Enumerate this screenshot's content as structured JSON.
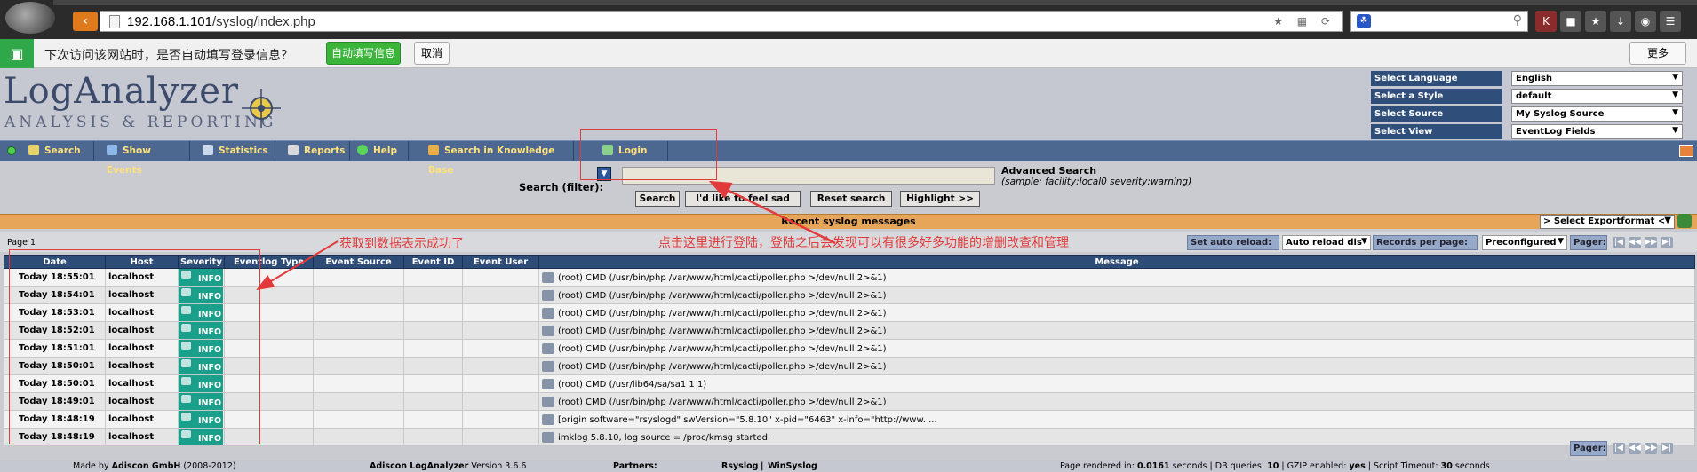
{
  "browser": {
    "url_host": "192.168.1.101",
    "url_path": "/syslog/index.php",
    "password_bar": {
      "message": "下次访问该网站时，是否自动填写登录信息？",
      "autofill_label": "自动填写信息",
      "cancel_label": "取消",
      "more_label": "更多"
    }
  },
  "app": {
    "logo_main": "LogAnalyzer",
    "logo_sub": "ANALYSIS & REPORTING",
    "selectors": [
      {
        "label": "Select Language",
        "value": "English"
      },
      {
        "label": "Select a Style",
        "value": "default"
      },
      {
        "label": "Select Source",
        "value": "My Syslog Source"
      },
      {
        "label": "Select View",
        "value": "EventLog Fields"
      }
    ],
    "nav": [
      "Search",
      "Show Events",
      "Statistics",
      "Reports",
      "Help",
      "Search in Knowledge Base",
      "Login"
    ]
  },
  "search": {
    "label": "Search (filter):",
    "advanced_label": "Advanced Search",
    "sample": "(sample: facility:local0 severity:warning)",
    "buttons": [
      "Search",
      "I'd like to feel sad",
      "Reset search",
      "Highlight >>"
    ]
  },
  "results": {
    "title": "Recent syslog messages",
    "export_label": "> Select Exportformat <",
    "page_label": "Page 1",
    "auto_reload_label": "Set auto reload:",
    "auto_reload_value": "Auto reload dis",
    "records_label": "Records per page:",
    "records_value": "Preconfigured",
    "pager_label": "Pager:",
    "columns": [
      "Date",
      "Host",
      "Severity",
      "Eventlog Type",
      "Event Source",
      "Event ID",
      "Event User",
      "Message"
    ],
    "rows": [
      {
        "date": "Today 18:55:01",
        "host": "localhost",
        "severity": "INFO",
        "message": "(root) CMD (/usr/bin/php /var/www/html/cacti/poller.php >/dev/null 2>&1)"
      },
      {
        "date": "Today 18:54:01",
        "host": "localhost",
        "severity": "INFO",
        "message": "(root) CMD (/usr/bin/php /var/www/html/cacti/poller.php >/dev/null 2>&1)"
      },
      {
        "date": "Today 18:53:01",
        "host": "localhost",
        "severity": "INFO",
        "message": "(root) CMD (/usr/bin/php /var/www/html/cacti/poller.php >/dev/null 2>&1)"
      },
      {
        "date": "Today 18:52:01",
        "host": "localhost",
        "severity": "INFO",
        "message": "(root) CMD (/usr/bin/php /var/www/html/cacti/poller.php >/dev/null 2>&1)"
      },
      {
        "date": "Today 18:51:01",
        "host": "localhost",
        "severity": "INFO",
        "message": "(root) CMD (/usr/bin/php /var/www/html/cacti/poller.php >/dev/null 2>&1)"
      },
      {
        "date": "Today 18:50:01",
        "host": "localhost",
        "severity": "INFO",
        "message": "(root) CMD (/usr/bin/php /var/www/html/cacti/poller.php >/dev/null 2>&1)"
      },
      {
        "date": "Today 18:50:01",
        "host": "localhost",
        "severity": "INFO",
        "message": "(root) CMD (/usr/lib64/sa/sa1 1 1)"
      },
      {
        "date": "Today 18:49:01",
        "host": "localhost",
        "severity": "INFO",
        "message": "(root) CMD (/usr/bin/php /var/www/html/cacti/poller.php >/dev/null 2>&1)"
      },
      {
        "date": "Today 18:48:19",
        "host": "localhost",
        "severity": "INFO",
        "message": "[origin software=\"rsyslogd\" swVersion=\"5.8.10\" x-pid=\"6463\" x-info=\"http://www. ..."
      },
      {
        "date": "Today 18:48:19",
        "host": "localhost",
        "severity": "INFO",
        "message": "imklog 5.8.10, log source = /proc/kmsg started."
      }
    ]
  },
  "footer": {
    "made_by_prefix": "Made by",
    "made_by_company": "Adiscon GmbH",
    "made_by_years": "(2008-2012)",
    "product": "Adiscon LogAnalyzer",
    "version": "Version 3.6.6",
    "partners_label": "Partners:",
    "partner1": "Rsyslog",
    "partner2": "WinSyslog",
    "rendered_label": "Page rendered in:",
    "rendered_value": "0.0161",
    "rendered_unit": "seconds",
    "dbq_label": "DB queries:",
    "dbq_value": "10",
    "gzip_label": "GZIP enabled:",
    "gzip_value": "yes",
    "timeout_label": "Script Timeout:",
    "timeout_value": "30",
    "timeout_unit": "seconds"
  },
  "annotations": {
    "data_success": "获取到数据表示成功了",
    "login_hint": "点击这里进行登陆，登陆之后会发现可以有很多好多功能的增删改查和管理",
    "color": "#e23a3a"
  }
}
